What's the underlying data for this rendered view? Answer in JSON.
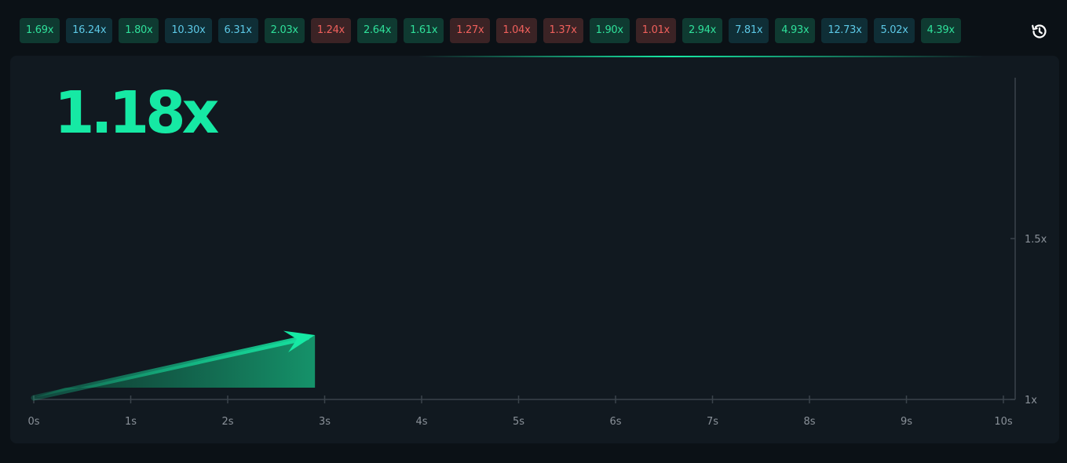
{
  "history": [
    {
      "value": "1.69x",
      "tone": "green"
    },
    {
      "value": "16.24x",
      "tone": "teal"
    },
    {
      "value": "1.80x",
      "tone": "green"
    },
    {
      "value": "10.30x",
      "tone": "teal"
    },
    {
      "value": "6.31x",
      "tone": "teal"
    },
    {
      "value": "2.03x",
      "tone": "green"
    },
    {
      "value": "1.24x",
      "tone": "red"
    },
    {
      "value": "2.64x",
      "tone": "green"
    },
    {
      "value": "1.61x",
      "tone": "green"
    },
    {
      "value": "1.27x",
      "tone": "red"
    },
    {
      "value": "1.04x",
      "tone": "red"
    },
    {
      "value": "1.37x",
      "tone": "red"
    },
    {
      "value": "1.90x",
      "tone": "green"
    },
    {
      "value": "1.01x",
      "tone": "red"
    },
    {
      "value": "2.94x",
      "tone": "green"
    },
    {
      "value": "7.81x",
      "tone": "teal"
    },
    {
      "value": "4.93x",
      "tone": "green"
    },
    {
      "value": "12.73x",
      "tone": "teal"
    },
    {
      "value": "5.02x",
      "tone": "teal"
    },
    {
      "value": "4.39x",
      "tone": "green"
    }
  ],
  "history_icon": "history-clock-icon",
  "game": {
    "current_multiplier": "1.18x"
  },
  "colors": {
    "accent": "#16e9a4",
    "green_text": "#2fe09a",
    "teal_text": "#5cc8e6",
    "red_text": "#f0605c"
  },
  "chart_data": {
    "type": "line",
    "x_ticks": [
      "0s",
      "1s",
      "2s",
      "3s",
      "4s",
      "5s",
      "6s",
      "7s",
      "8s",
      "9s",
      "10s"
    ],
    "y_ticks": [
      {
        "label": "1.5x",
        "value": 1.5
      },
      {
        "label": "1x",
        "value": 1.0
      }
    ],
    "xlim": [
      0,
      10
    ],
    "ylim": [
      1.0,
      2.0
    ],
    "series": [
      {
        "x": [
          0,
          2.9
        ],
        "y": [
          1.0,
          1.2
        ]
      }
    ],
    "grid": false
  }
}
